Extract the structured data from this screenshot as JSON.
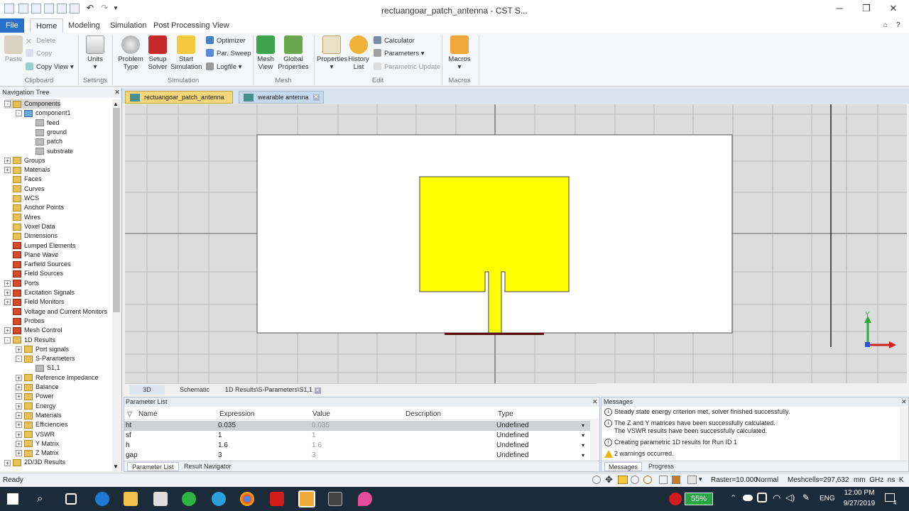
{
  "app": {
    "title": "rectuangoar_patch_antenna - CST S...",
    "menu_tabs": [
      "File",
      "Home",
      "Modeling",
      "Simulation",
      "Post Processing",
      "View"
    ]
  },
  "ribbon": {
    "clipboard": {
      "paste": "Paste",
      "delete": "Delete",
      "copy": "Copy",
      "copy_view": "Copy View",
      "group": "Clipboard"
    },
    "settings": {
      "units": "Units",
      "group": "Settings"
    },
    "simulation": {
      "problem_type": "Problem Type",
      "setup_solver": "Setup Solver",
      "start_simulation": "Start Simulation",
      "optimizer": "Optimizer",
      "par_sweep": "Par. Sweep",
      "logfile": "Logfile",
      "group": "Simulation"
    },
    "mesh": {
      "mesh_view": "Mesh View",
      "global_properties": "Global Properties",
      "group": "Mesh"
    },
    "edit": {
      "properties": "Properties",
      "history_list": "History List",
      "calculator": "Calculator",
      "parameters": "Parameters",
      "parametric_update": "Parametric Update",
      "group": "Edit"
    },
    "macros": {
      "macros": "Macros",
      "group": "Macros"
    }
  },
  "nav": {
    "header": "Navigation Tree",
    "items": [
      "Components",
      "component1",
      "feed",
      "ground",
      "patch",
      "substrate",
      "Groups",
      "Materials",
      "Faces",
      "Curves",
      "WCS",
      "Anchor Points",
      "Wires",
      "Voxel Data",
      "Dimensions",
      "Lumped Elements",
      "Plane Wave",
      "Farfield Sources",
      "Field Sources",
      "Ports",
      "Excitation Signals",
      "Field Monitors",
      "Voltage and Current Monitors",
      "Probes",
      "Mesh Control",
      "1D Results",
      "Port signals",
      "S-Parameters",
      "S1,1",
      "Reference Impedance",
      "Balance",
      "Power",
      "Energy",
      "Materials",
      "Efficiencies",
      "VSWR",
      "Y Matrix",
      "Z Matrix",
      "2D/3D Results"
    ]
  },
  "doc_tabs": [
    "rectuangoar_patch_antenna",
    "wearable antenna"
  ],
  "view_tabs": [
    "3D",
    "Schematic",
    "1D Results\\S-Parameters\\S1,1"
  ],
  "axes": {
    "y": "Y"
  },
  "param_list": {
    "header": "Parameter List",
    "columns": [
      "Name",
      "Expression",
      "Value",
      "Description",
      "Type"
    ],
    "rows": [
      {
        "name": "ht",
        "expression": "0.035",
        "value": "0.035",
        "description": "",
        "type": "Undefined"
      },
      {
        "name": "sf",
        "expression": "1",
        "value": "1",
        "description": "",
        "type": "Undefined"
      },
      {
        "name": "h",
        "expression": "1.6",
        "value": "1.6",
        "description": "",
        "type": "Undefined"
      },
      {
        "name": "gap",
        "expression": "3",
        "value": "3",
        "description": "",
        "type": "Undefined"
      }
    ],
    "bottom_tabs": [
      "Parameter List",
      "Result Navigator"
    ]
  },
  "messages": {
    "header": "Messages",
    "items": [
      {
        "kind": "info",
        "lines": [
          "Steady state energy criterion met, solver finished successfully."
        ]
      },
      {
        "kind": "info",
        "lines": [
          "The Z and Y matrices have been successfully calculated.",
          "The VSWR results have been successfully calculated."
        ]
      },
      {
        "kind": "info",
        "lines": [
          "Creating parametric 1D results for Run ID 1"
        ]
      },
      {
        "kind": "warning",
        "lines": [
          "2 warnings occurred."
        ]
      }
    ],
    "tabs": [
      "Messages",
      "Progress"
    ]
  },
  "status": {
    "ready": "Ready",
    "raster": "Raster=10.000",
    "mode": "Normal",
    "meshcells": "Meshcells=297,632",
    "units": "mm  GHz  ns  K"
  },
  "taskbar": {
    "battery": "55%",
    "lang": "ENG",
    "time": "12:00 PM",
    "date": "9/27/2019",
    "notif": "4"
  },
  "colors": {
    "patch": "#ffff00",
    "substrate": "#ffffff",
    "ground": "#5a1010",
    "accent": "#2a6fc9",
    "bg": "#dcdcdc"
  }
}
